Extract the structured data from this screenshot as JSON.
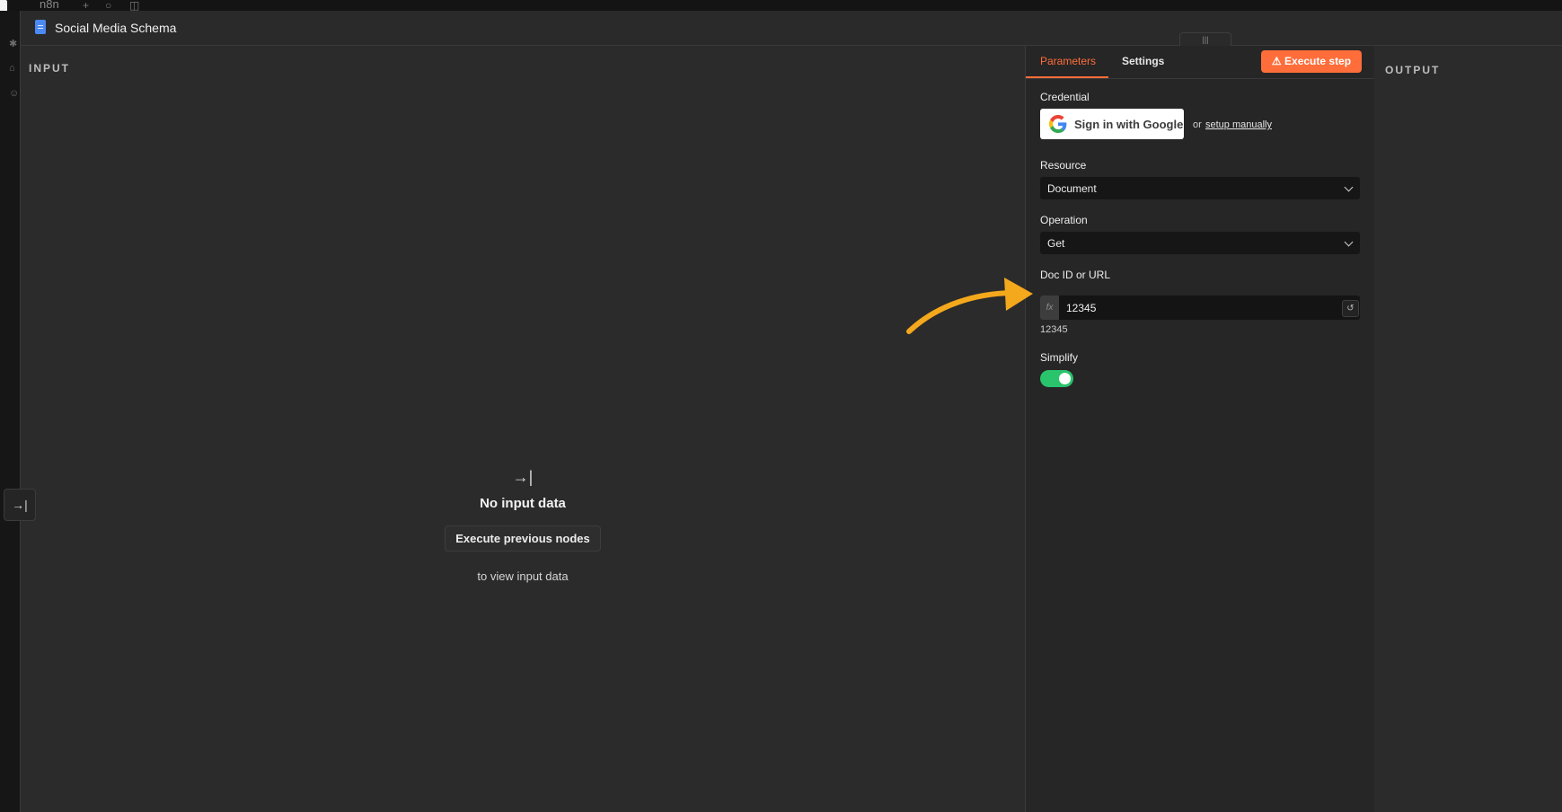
{
  "app": {
    "brand": "n8n"
  },
  "modal": {
    "title": "Social Media Schema",
    "drag_handle": "|||"
  },
  "input_panel": {
    "label": "INPUT",
    "empty_icon": "→|",
    "empty_title": "No input data",
    "execute_previous_label": "Execute previous nodes",
    "empty_hint": "to view input data"
  },
  "params_panel": {
    "tabs": [
      {
        "label": "Parameters",
        "active": true
      },
      {
        "label": "Settings",
        "active": false
      }
    ],
    "execute_step_label": "Execute step",
    "execute_icon": "⚠",
    "credential": {
      "label": "Credential",
      "google_label": "Sign in with Google",
      "or_text": "or",
      "setup_link": "setup manually"
    },
    "resource": {
      "label": "Resource",
      "value": "Document"
    },
    "operation": {
      "label": "Operation",
      "value": "Get"
    },
    "doc_id": {
      "label": "Doc ID or URL",
      "fx": "fx",
      "value": "12345",
      "resolved": "12345"
    },
    "simplify": {
      "label": "Simplify",
      "enabled": true
    }
  },
  "output_panel": {
    "label": "OUTPUT"
  },
  "colors": {
    "accent": "#ff6d3a",
    "toggle_on": "#29c46b",
    "annotation_arrow": "#f4a81c",
    "doc_icon": "#4b8af4"
  }
}
